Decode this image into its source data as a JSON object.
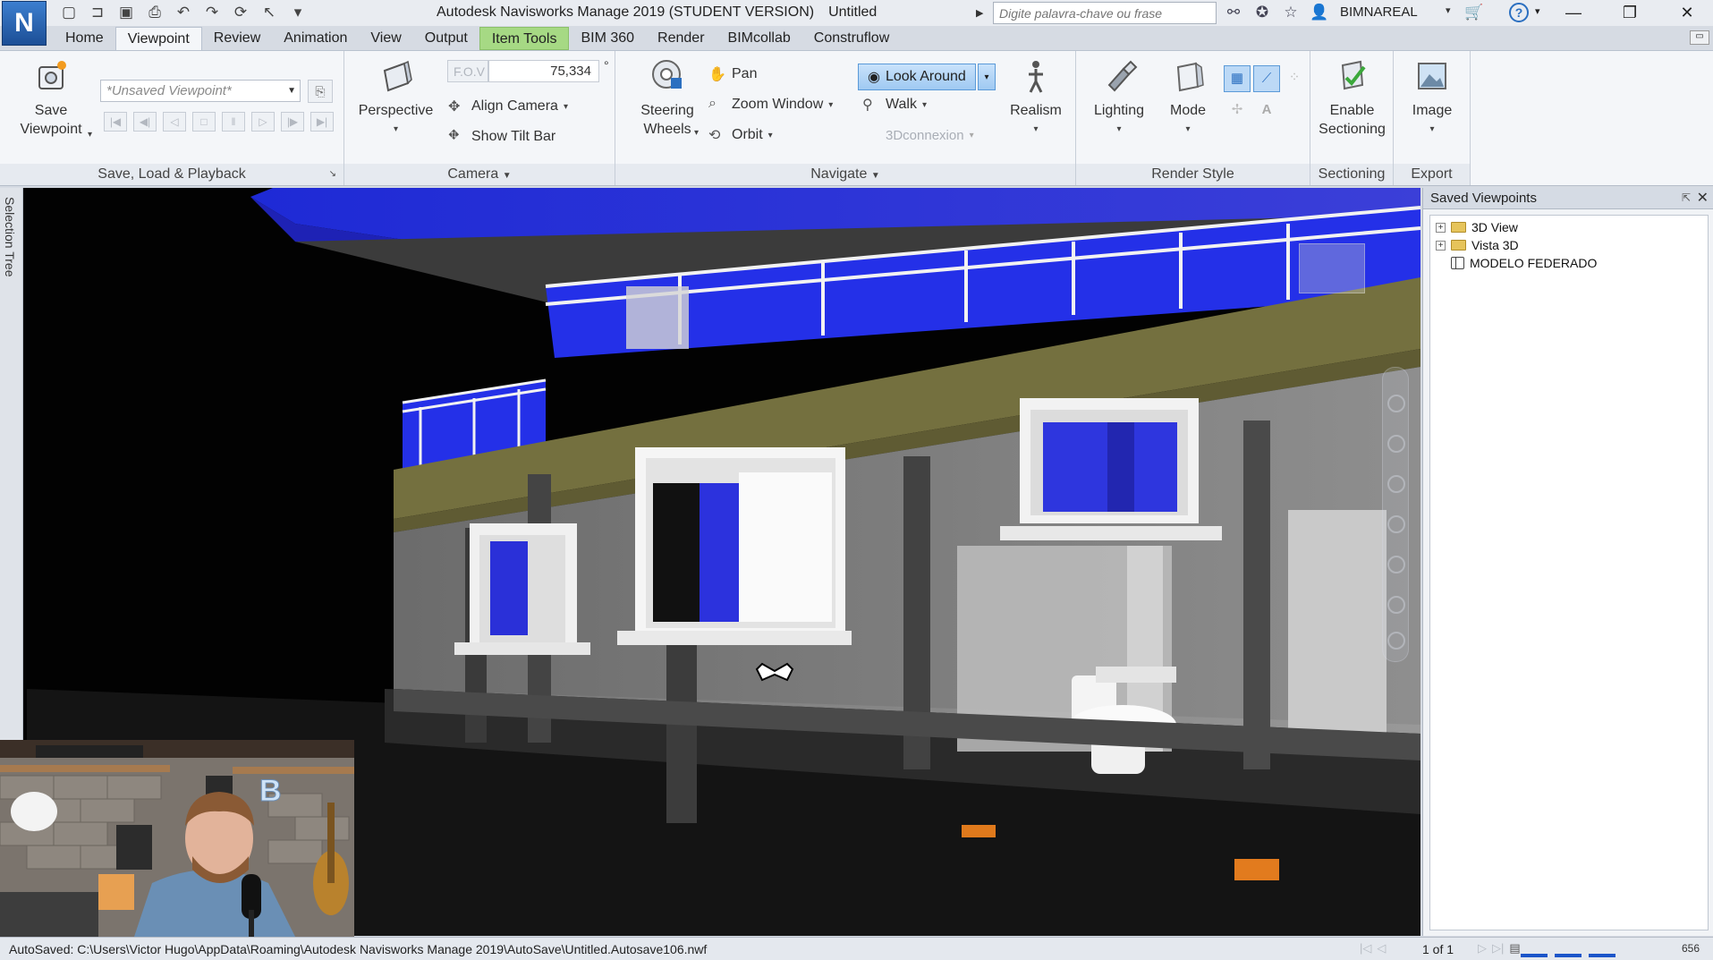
{
  "app": {
    "logo_letter": "N",
    "title": "Autodesk Navisworks Manage 2019 (STUDENT VERSION)",
    "document": "Untitled",
    "search_placeholder": "Digite palavra-chave ou frase",
    "user": "BIMNAREAL"
  },
  "tabs": [
    "Home",
    "Viewpoint",
    "Review",
    "Animation",
    "View",
    "Output",
    "Item Tools",
    "BIM 360",
    "Render",
    "BIMcollab",
    "Construflow"
  ],
  "active_tab": "Viewpoint",
  "ribbon": {
    "save_load": {
      "title": "Save, Load & Playback",
      "save_label_1": "Save",
      "save_label_2": "Viewpoint",
      "viewpoint_value": "*Unsaved Viewpoint*"
    },
    "camera": {
      "title": "Camera",
      "perspective": "Perspective",
      "align_camera": "Align Camera",
      "show_tilt_bar": "Show Tilt Bar",
      "fov_label": "F.O.V",
      "fov_value": "75,334",
      "fov_unit": "°"
    },
    "navigate": {
      "title": "Navigate",
      "steering_1": "Steering",
      "steering_2": "Wheels",
      "pan": "Pan",
      "zoom_window": "Zoom Window",
      "orbit": "Orbit",
      "look_around": "Look Around",
      "walk": "Walk",
      "connexion": "3Dconnexion",
      "realism": "Realism"
    },
    "render_style": {
      "title": "Render Style",
      "lighting": "Lighting",
      "mode": "Mode"
    },
    "sectioning": {
      "title": "Sectioning",
      "enable_1": "Enable",
      "enable_2": "Sectioning"
    },
    "export": {
      "title": "Export",
      "image": "Image"
    }
  },
  "selection_tree_tab": "Selection Tree",
  "saved_viewpoints": {
    "title": "Saved Viewpoints",
    "items": [
      {
        "label": "3D View",
        "kind": "folder"
      },
      {
        "label": "Vista 3D",
        "kind": "folder"
      },
      {
        "label": "MODELO FEDERADO",
        "kind": "viewpoint"
      }
    ]
  },
  "status": {
    "autosave": "AutoSaved: C:\\Users\\Victor Hugo\\AppData\\Roaming\\Autodesk Navisworks Manage 2019\\AutoSave\\Untitled.Autosave106.nwf",
    "page": "1 of 1",
    "memory": "656"
  },
  "colors": {
    "glass": "#1d2be8",
    "accent": "#2b6fc0",
    "item_tools_tab": "#a6d984"
  }
}
